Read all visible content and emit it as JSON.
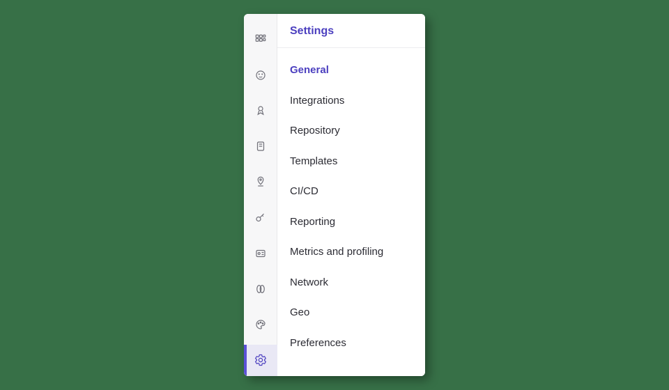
{
  "flyout": {
    "title": "Settings",
    "items": [
      {
        "label": "General",
        "active": true
      },
      {
        "label": "Integrations"
      },
      {
        "label": "Repository"
      },
      {
        "label": "Templates"
      },
      {
        "label": "CI/CD"
      },
      {
        "label": "Reporting"
      },
      {
        "label": "Metrics and profiling"
      },
      {
        "label": "Network"
      },
      {
        "label": "Geo"
      },
      {
        "label": "Preferences"
      }
    ]
  },
  "iconbar": {
    "items": [
      {
        "name": "apps-icon"
      },
      {
        "name": "face-icon"
      },
      {
        "name": "award-icon"
      },
      {
        "name": "book-icon"
      },
      {
        "name": "pin-icon"
      },
      {
        "name": "key-icon"
      },
      {
        "name": "id-card-icon"
      },
      {
        "name": "tokens-icon"
      },
      {
        "name": "palette-icon"
      },
      {
        "name": "gear-icon",
        "active": true
      }
    ]
  }
}
